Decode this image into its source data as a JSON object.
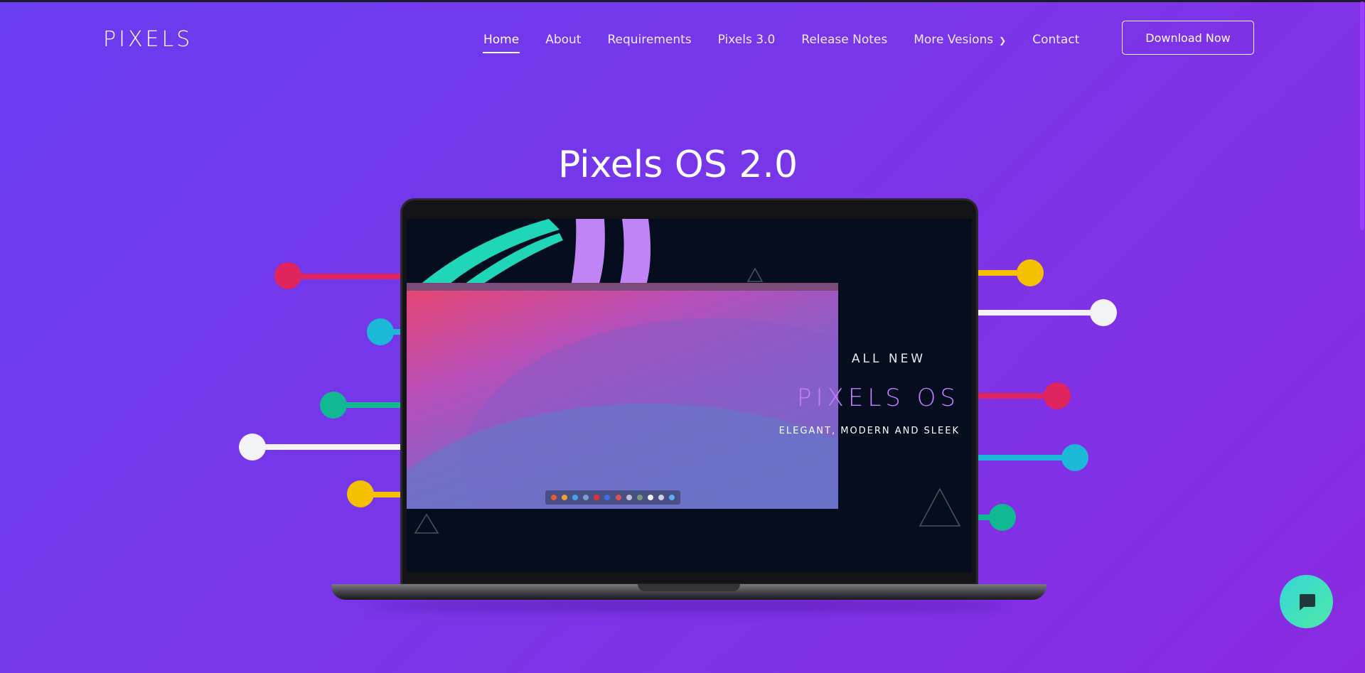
{
  "header": {
    "logo": "PIXELS",
    "nav": [
      {
        "label": "Home",
        "active": true
      },
      {
        "label": "About"
      },
      {
        "label": "Requirements"
      },
      {
        "label": "Pixels 3.0"
      },
      {
        "label": "Release Notes"
      },
      {
        "label": "More Vesions",
        "dropdown": true
      },
      {
        "label": "Contact"
      }
    ],
    "download_label": "Download Now"
  },
  "hero": {
    "title": "Pixels OS 2.0",
    "screen": {
      "all_new": "ALL NEW",
      "product": "PIXELS OS",
      "tagline": "ELEGANT, MODERN AND SLEEK"
    }
  },
  "chat": {
    "icon": "chat-bubble-icon"
  },
  "colors": {
    "bg_start": "#6a3cf0",
    "bg_end": "#8a2be2",
    "accent_pink": "#e0245e",
    "accent_cyan": "#1bb8d8",
    "accent_green": "#10b992",
    "accent_yellow": "#f5c000",
    "accent_white": "#f4f4f8",
    "screen_purple": "#c77dff"
  }
}
